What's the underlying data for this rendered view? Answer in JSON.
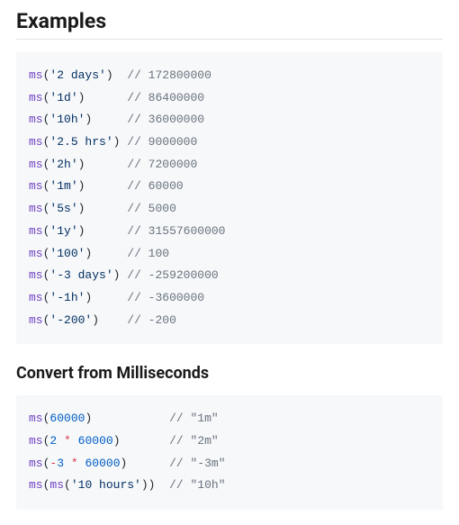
{
  "section1": {
    "heading": "Examples",
    "lines": [
      {
        "tokens": [
          [
            "fn",
            "ms"
          ],
          [
            "punc",
            "("
          ],
          [
            "str",
            "'2 days'"
          ],
          [
            "punc",
            ")"
          ]
        ],
        "pad": 13,
        "comment": "// 172800000"
      },
      {
        "tokens": [
          [
            "fn",
            "ms"
          ],
          [
            "punc",
            "("
          ],
          [
            "str",
            "'1d'"
          ],
          [
            "punc",
            ")"
          ]
        ],
        "pad": 13,
        "comment": "// 86400000"
      },
      {
        "tokens": [
          [
            "fn",
            "ms"
          ],
          [
            "punc",
            "("
          ],
          [
            "str",
            "'10h'"
          ],
          [
            "punc",
            ")"
          ]
        ],
        "pad": 13,
        "comment": "// 36000000"
      },
      {
        "tokens": [
          [
            "fn",
            "ms"
          ],
          [
            "punc",
            "("
          ],
          [
            "str",
            "'2.5 hrs'"
          ],
          [
            "punc",
            ")"
          ]
        ],
        "pad": 13,
        "comment": "// 9000000"
      },
      {
        "tokens": [
          [
            "fn",
            "ms"
          ],
          [
            "punc",
            "("
          ],
          [
            "str",
            "'2h'"
          ],
          [
            "punc",
            ")"
          ]
        ],
        "pad": 13,
        "comment": "// 7200000"
      },
      {
        "tokens": [
          [
            "fn",
            "ms"
          ],
          [
            "punc",
            "("
          ],
          [
            "str",
            "'1m'"
          ],
          [
            "punc",
            ")"
          ]
        ],
        "pad": 13,
        "comment": "// 60000"
      },
      {
        "tokens": [
          [
            "fn",
            "ms"
          ],
          [
            "punc",
            "("
          ],
          [
            "str",
            "'5s'"
          ],
          [
            "punc",
            ")"
          ]
        ],
        "pad": 13,
        "comment": "// 5000"
      },
      {
        "tokens": [
          [
            "fn",
            "ms"
          ],
          [
            "punc",
            "("
          ],
          [
            "str",
            "'1y'"
          ],
          [
            "punc",
            ")"
          ]
        ],
        "pad": 13,
        "comment": "// 31557600000"
      },
      {
        "tokens": [
          [
            "fn",
            "ms"
          ],
          [
            "punc",
            "("
          ],
          [
            "str",
            "'100'"
          ],
          [
            "punc",
            ")"
          ]
        ],
        "pad": 13,
        "comment": "// 100"
      },
      {
        "tokens": [
          [
            "fn",
            "ms"
          ],
          [
            "punc",
            "("
          ],
          [
            "str",
            "'-3 days'"
          ],
          [
            "punc",
            ")"
          ]
        ],
        "pad": 13,
        "comment": "// -259200000"
      },
      {
        "tokens": [
          [
            "fn",
            "ms"
          ],
          [
            "punc",
            "("
          ],
          [
            "str",
            "'-1h'"
          ],
          [
            "punc",
            ")"
          ]
        ],
        "pad": 13,
        "comment": "// -3600000"
      },
      {
        "tokens": [
          [
            "fn",
            "ms"
          ],
          [
            "punc",
            "("
          ],
          [
            "str",
            "'-200'"
          ],
          [
            "punc",
            ")"
          ]
        ],
        "pad": 13,
        "comment": "// -200"
      }
    ]
  },
  "section2": {
    "heading": "Convert from Milliseconds",
    "lines": [
      {
        "tokens": [
          [
            "fn",
            "ms"
          ],
          [
            "punc",
            "("
          ],
          [
            "num",
            "60000"
          ],
          [
            "punc",
            ")"
          ]
        ],
        "pad": 19,
        "comment": "// \"1m\""
      },
      {
        "tokens": [
          [
            "fn",
            "ms"
          ],
          [
            "punc",
            "("
          ],
          [
            "num",
            "2"
          ],
          [
            "plain",
            " "
          ],
          [
            "op",
            "*"
          ],
          [
            "plain",
            " "
          ],
          [
            "num",
            "60000"
          ],
          [
            "punc",
            ")"
          ]
        ],
        "pad": 19,
        "comment": "// \"2m\""
      },
      {
        "tokens": [
          [
            "fn",
            "ms"
          ],
          [
            "punc",
            "("
          ],
          [
            "op",
            "-"
          ],
          [
            "num",
            "3"
          ],
          [
            "plain",
            " "
          ],
          [
            "op",
            "*"
          ],
          [
            "plain",
            " "
          ],
          [
            "num",
            "60000"
          ],
          [
            "punc",
            ")"
          ]
        ],
        "pad": 19,
        "comment": "// \"-3m\""
      },
      {
        "tokens": [
          [
            "fn",
            "ms"
          ],
          [
            "punc",
            "("
          ],
          [
            "fn",
            "ms"
          ],
          [
            "punc",
            "("
          ],
          [
            "str",
            "'10 hours'"
          ],
          [
            "punc",
            ")"
          ],
          [
            "punc",
            ")"
          ]
        ],
        "pad": 19,
        "comment": "// \"10h\""
      }
    ]
  }
}
